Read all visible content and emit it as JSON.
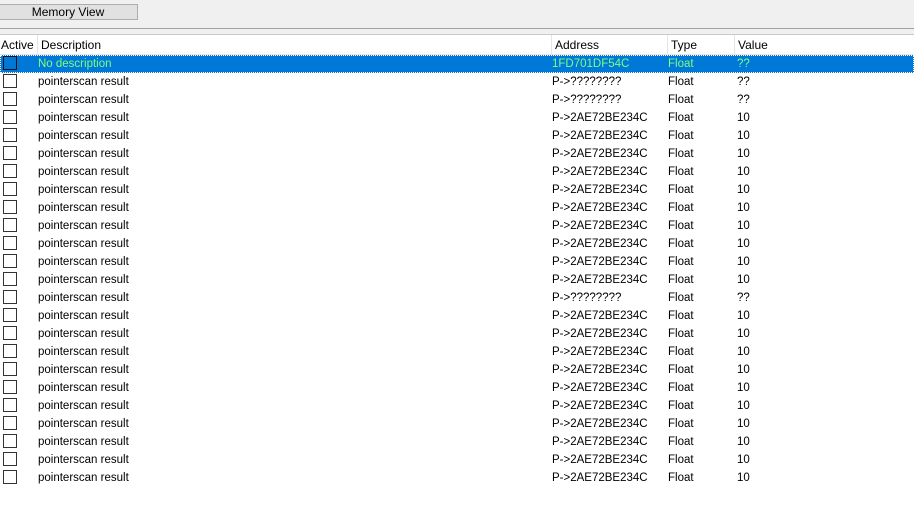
{
  "toolbar": {
    "memory_view_label": "Memory View"
  },
  "columns": {
    "active": "Active",
    "description": "Description",
    "address": "Address",
    "type": "Type",
    "value": "Value"
  },
  "colors": {
    "selection_bg": "#0078d7",
    "selection_text": "#7cff7c"
  },
  "rows": [
    {
      "active": false,
      "selected": true,
      "description": "No description",
      "address": "1FD701DF54C",
      "type": "Float",
      "value": "??"
    },
    {
      "active": false,
      "description": "pointerscan result",
      "address": "P->????????",
      "type": "Float",
      "value": "??"
    },
    {
      "active": false,
      "description": "pointerscan result",
      "address": "P->????????",
      "type": "Float",
      "value": "??"
    },
    {
      "active": false,
      "description": "pointerscan result",
      "address": "P->2AE72BE234C",
      "type": "Float",
      "value": "10"
    },
    {
      "active": false,
      "description": "pointerscan result",
      "address": "P->2AE72BE234C",
      "type": "Float",
      "value": "10"
    },
    {
      "active": false,
      "description": "pointerscan result",
      "address": "P->2AE72BE234C",
      "type": "Float",
      "value": "10"
    },
    {
      "active": false,
      "description": "pointerscan result",
      "address": "P->2AE72BE234C",
      "type": "Float",
      "value": "10"
    },
    {
      "active": false,
      "description": "pointerscan result",
      "address": "P->2AE72BE234C",
      "type": "Float",
      "value": "10"
    },
    {
      "active": false,
      "description": "pointerscan result",
      "address": "P->2AE72BE234C",
      "type": "Float",
      "value": "10"
    },
    {
      "active": false,
      "description": "pointerscan result",
      "address": "P->2AE72BE234C",
      "type": "Float",
      "value": "10"
    },
    {
      "active": false,
      "description": "pointerscan result",
      "address": "P->2AE72BE234C",
      "type": "Float",
      "value": "10"
    },
    {
      "active": false,
      "description": "pointerscan result",
      "address": "P->2AE72BE234C",
      "type": "Float",
      "value": "10"
    },
    {
      "active": false,
      "description": "pointerscan result",
      "address": "P->2AE72BE234C",
      "type": "Float",
      "value": "10"
    },
    {
      "active": false,
      "description": "pointerscan result",
      "address": "P->????????",
      "type": "Float",
      "value": "??"
    },
    {
      "active": false,
      "description": "pointerscan result",
      "address": "P->2AE72BE234C",
      "type": "Float",
      "value": "10"
    },
    {
      "active": false,
      "description": "pointerscan result",
      "address": "P->2AE72BE234C",
      "type": "Float",
      "value": "10"
    },
    {
      "active": false,
      "description": "pointerscan result",
      "address": "P->2AE72BE234C",
      "type": "Float",
      "value": "10"
    },
    {
      "active": false,
      "description": "pointerscan result",
      "address": "P->2AE72BE234C",
      "type": "Float",
      "value": "10"
    },
    {
      "active": false,
      "description": "pointerscan result",
      "address": "P->2AE72BE234C",
      "type": "Float",
      "value": "10"
    },
    {
      "active": false,
      "description": "pointerscan result",
      "address": "P->2AE72BE234C",
      "type": "Float",
      "value": "10"
    },
    {
      "active": false,
      "description": "pointerscan result",
      "address": "P->2AE72BE234C",
      "type": "Float",
      "value": "10"
    },
    {
      "active": false,
      "description": "pointerscan result",
      "address": "P->2AE72BE234C",
      "type": "Float",
      "value": "10"
    },
    {
      "active": false,
      "description": "pointerscan result",
      "address": "P->2AE72BE234C",
      "type": "Float",
      "value": "10"
    },
    {
      "active": false,
      "description": "pointerscan result",
      "address": "P->2AE72BE234C",
      "type": "Float",
      "value": "10"
    }
  ]
}
